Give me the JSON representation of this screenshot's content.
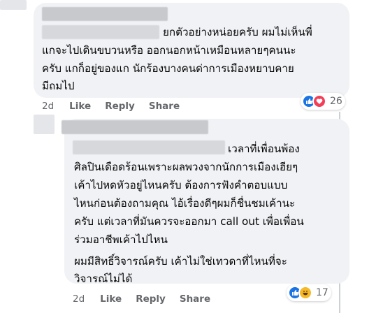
{
  "comment1": {
    "lines": [
      "ยกตัวอย่างหน่อยครับ ผมไม่เห็นพี่",
      "แกจะไปเดินขบวนหรือ ออกนอกหน้าเหมือนหลายๆคนนะ",
      "ครับ แกก็อยู่ของแก นักร้องบางคนด่าการเมืองหยาบคาย",
      "มีถมไป"
    ],
    "time": "2d",
    "like_label": "Like",
    "reply_label": "Reply",
    "share_label": "Share",
    "reaction_count": "26",
    "reactions": [
      "like-icon",
      "love-icon"
    ]
  },
  "comment2": {
    "para1": [
      "เวลาที่เพื่อนพ้อง",
      "ศิลปินเดือดร้อนเพราะผลพวงจากนักการเมืองเฮียๆ",
      "เค้าไปหดหัวอยู่ไหนครับ ต้องการฟังคำตอบแบบ",
      "ไหนก่อนต้องถามคุณ ไอ้เรื่องดีๆผมก็ชื่นชมเค้านะ",
      "ครับ แต่เวลาที่มันควรจะออกมา call out เพื่อเพื่อน",
      "ร่วมอาชีพเค้าไปไหน"
    ],
    "para2": [
      "ผมมีสิทธิ์วิจารณ์ครับ เค้าไม่ใช่เทวดาที่ไหนที่จะ",
      "วิจารณ์ไม่ได้"
    ],
    "time": "2d",
    "like_label": "Like",
    "reply_label": "Reply",
    "share_label": "Share",
    "reaction_count": "17",
    "reactions": [
      "like-icon",
      "haha-icon"
    ]
  },
  "colors": {
    "bubble": "#f0f2f5",
    "meta": "#65676b",
    "like": "#1b74e4",
    "love": "#f33e58",
    "haha": "#f7b928"
  }
}
